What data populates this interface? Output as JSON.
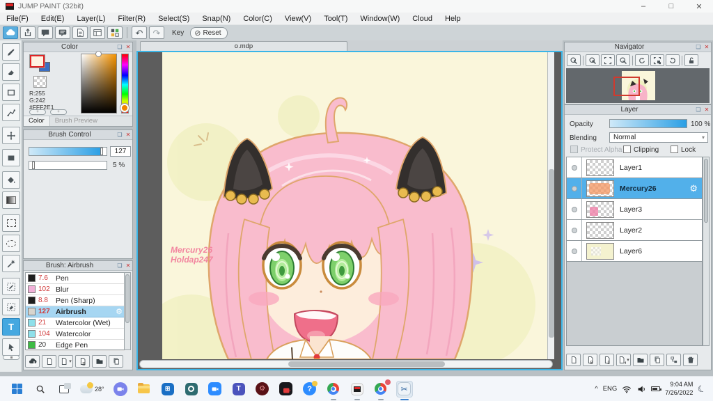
{
  "window": {
    "title": "JUMP PAINT (32bit)"
  },
  "menu": {
    "items": [
      "File(F)",
      "Edit(E)",
      "Layer(L)",
      "Filter(R)",
      "Select(S)",
      "Snap(N)",
      "Color(C)",
      "View(V)",
      "Tool(T)",
      "Window(W)",
      "Cloud",
      "Help"
    ]
  },
  "toolbar": {
    "key_label": "Key",
    "reset_label": "Reset"
  },
  "icons": {
    "undo": "↶",
    "redo": "↷",
    "close": "✕",
    "popout": "❏",
    "minimize": "–",
    "maximize": "□",
    "no_sign": "⊘",
    "gear": "⚙",
    "dropdown": "▾",
    "scissors": "✂",
    "moon": "☾",
    "chevron_up": "^"
  },
  "color_panel": {
    "title": "Color",
    "values": {
      "r": "R:255",
      "g": "G:242",
      "hex": "#FFF2E1"
    },
    "foreground_color": "#FFF2E1",
    "background_color": "#3A6EC4",
    "tabs": [
      {
        "label": "Color",
        "active": true
      },
      {
        "label": "Brush Preview",
        "active": false
      }
    ]
  },
  "brush_control": {
    "title": "Brush Control",
    "size_value": "127",
    "opacity_value": "5 %"
  },
  "brush_panel": {
    "title": "Brush: Airbrush",
    "brushes": [
      {
        "size": "7.6",
        "name": "Pen",
        "swatch": "#1e1e1e",
        "selected": false
      },
      {
        "size": "102",
        "name": "Blur",
        "swatch": "#f0b0d8",
        "selected": false
      },
      {
        "size": "8.8",
        "name": "Pen (Sharp)",
        "swatch": "#1e1e1e",
        "selected": false
      },
      {
        "size": "127",
        "name": "Airbrush",
        "swatch": "#d8d5ce",
        "selected": true
      },
      {
        "size": "21",
        "name": "Watercolor (Wet)",
        "swatch": "#8fe0ea",
        "selected": false
      },
      {
        "size": "104",
        "name": "Watercolor",
        "swatch": "#8fe0ea",
        "selected": false
      },
      {
        "size": "20",
        "name": "Edge Pen",
        "swatch": "#3dbb44",
        "selected": false
      }
    ]
  },
  "canvas": {
    "tab": "o.mdp",
    "watermark_line1": "Mercury26",
    "watermark_line2": "Holdap247",
    "document_color": "#FAF6DB"
  },
  "navigator": {
    "title": "Navigator"
  },
  "layer_panel": {
    "title": "Layer",
    "opacity_label": "Opacity",
    "opacity_value": "100 %",
    "blending_label": "Blending",
    "blending_value": "Normal",
    "protect_alpha_label": "Protect Alpha",
    "clipping_label": "Clipping",
    "lock_label": "Lock",
    "layers": [
      {
        "name": "Layer1",
        "selected": false
      },
      {
        "name": "Mercury26",
        "selected": true
      },
      {
        "name": "Layer3",
        "selected": false
      },
      {
        "name": "Layer2",
        "selected": false
      },
      {
        "name": "Layer6",
        "selected": false
      }
    ]
  },
  "taskbar": {
    "weather_temp": "28°",
    "tray": {
      "language": "ENG",
      "time": "9:04 AM",
      "date": "7/26/2022"
    }
  }
}
